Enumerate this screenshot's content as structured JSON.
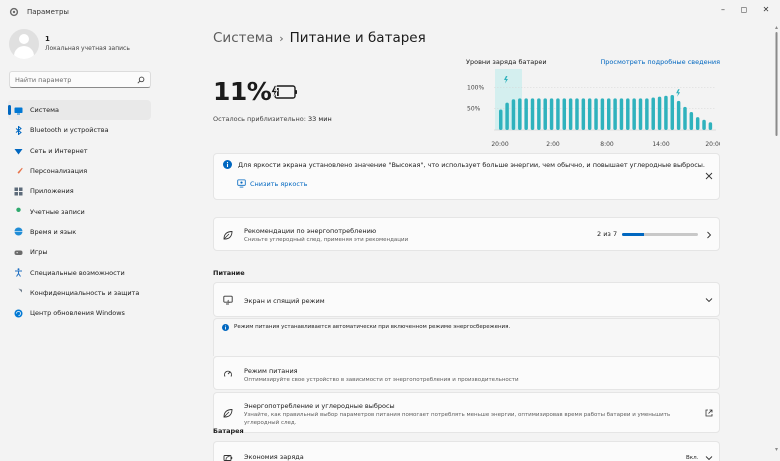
{
  "window": {
    "title": "Параметры"
  },
  "user": {
    "name": "1",
    "account_type": "Локальная учетная запись"
  },
  "search": {
    "placeholder": "Найти параметр"
  },
  "nav": {
    "items": [
      {
        "label": "Система",
        "icon": "system-icon",
        "color": "#0078d4",
        "active": true
      },
      {
        "label": "Bluetooth и устройства",
        "icon": "bluetooth-icon",
        "color": "#0067c0",
        "active": false
      },
      {
        "label": "Сеть и Интернет",
        "icon": "network-icon",
        "color": "#0067c0",
        "active": false
      },
      {
        "label": "Персонализация",
        "icon": "brush-icon",
        "color": "#e8734a",
        "active": false
      },
      {
        "label": "Приложения",
        "icon": "apps-icon",
        "color": "#5d6b7a",
        "active": false
      },
      {
        "label": "Учетные записи",
        "icon": "accounts-icon",
        "color": "#2faa6e",
        "active": false
      },
      {
        "label": "Время и язык",
        "icon": "globe-icon",
        "color": "#1f8cd6",
        "active": false
      },
      {
        "label": "Игры",
        "icon": "gamepad-icon",
        "color": "#6b6b6b",
        "active": false
      },
      {
        "label": "Специальные возможности",
        "icon": "accessibility-icon",
        "color": "#1f6fc2",
        "active": false
      },
      {
        "label": "Конфиденциальность и защита",
        "icon": "shield-icon",
        "color": "#6b7a8a",
        "active": false
      },
      {
        "label": "Центр обновления Windows",
        "icon": "update-icon",
        "color": "#0078d4",
        "active": false
      }
    ]
  },
  "breadcrumb": {
    "parent": "Система",
    "separator": "›",
    "current": "Питание и батарея"
  },
  "battery": {
    "percent": "11%",
    "remaining_label": "Осталось приблизительно:",
    "remaining_value": "33 мин",
    "level": 0.11
  },
  "chart_data": {
    "type": "bar",
    "title": "Уровни заряда батареи",
    "link": "Просмотреть подробные сведения",
    "y_ticks": [
      "100%",
      "50%"
    ],
    "x_ticks": [
      "20:00",
      "2:00",
      "8:00",
      "14:00",
      "20:00"
    ],
    "ylim": [
      0,
      100
    ],
    "values": [
      48,
      64,
      72,
      74,
      74,
      74,
      74,
      74,
      74,
      74,
      74,
      74,
      74,
      74,
      74,
      74,
      74,
      74,
      74,
      74,
      74,
      74,
      74,
      74,
      76,
      78,
      80,
      82,
      68,
      54,
      42,
      30,
      24,
      18
    ],
    "bar_color": "#2fb2bd",
    "highlight_color": "#d4efef"
  },
  "brightness_banner": {
    "text": "Для яркости экрана установлено значение \"Высокая\", что использует больше энергии, чем обычно, и повышает углеродные выбросы.",
    "action": "Снизить яркость"
  },
  "recommendations": {
    "title": "Рекомендации по энергопотреблению",
    "subtitle": "Снизьте углеродный след, применяя эти рекомендации",
    "count": "2 из 7",
    "progress": 0.2857
  },
  "power_section": {
    "title": "Питание",
    "screen_sleep": "Экран и спящий режим",
    "info": "Режим питания устанавливается автоматически при включенном режиме энергосбережения.",
    "power_mode": {
      "title": "Режим питания",
      "subtitle": "Оптимизируйте свое устройство в зависимости от энергопотребления и производительности"
    },
    "energy": {
      "title": "Энергопотребление и углеродные выбросы",
      "subtitle1": "Узнайте, как правильный выбор параметров питания помогает потреблять меньше энергии, оптимизировав время работы батареи и уменьшить",
      "subtitle2": "углеродный след."
    }
  },
  "battery_section": {
    "title": "Батарея",
    "saver": {
      "title": "Экономия заряда",
      "value": "Вкл."
    }
  }
}
